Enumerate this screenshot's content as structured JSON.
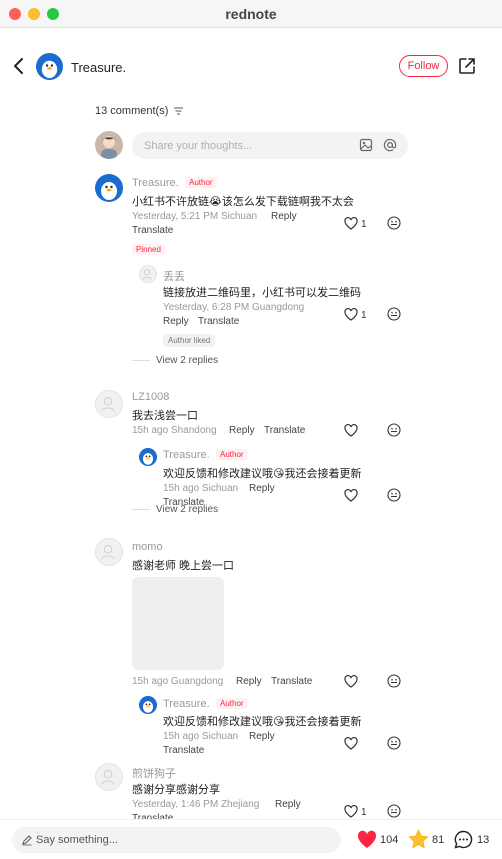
{
  "window": {
    "title": "rednote"
  },
  "header": {
    "author": "Treasure.",
    "follow_label": "Follow"
  },
  "comments_header": {
    "count_label": "13 comment(s)"
  },
  "composer": {
    "placeholder": "Share your thoughts..."
  },
  "comments": [
    {
      "user": "Treasure.",
      "badge": "Author",
      "text": "小红书不许放链😭该怎么发下载链啊我不太会",
      "meta": "Yesterday, 5:21 PM Sichuan",
      "reply": "Reply",
      "translate": "Translate",
      "pinned": "Pinned",
      "likes": "1",
      "replies": [
        {
          "user": "丢丢",
          "text": "链接放进二维码里，小红书可以发二维码",
          "meta": "Yesterday, 6:28 PM Guangdong",
          "reply": "Reply",
          "translate": "Translate",
          "author_liked": "Author liked",
          "likes": "1"
        }
      ],
      "view_replies": "View 2 replies"
    },
    {
      "user": "LZ1008",
      "text": "我去浅尝一口",
      "meta": "15h ago Shandong",
      "reply": "Reply",
      "translate": "Translate",
      "replies": [
        {
          "user": "Treasure.",
          "badge": "Author",
          "text": "欢迎反馈和修改建议哦😘我还会接着更新",
          "meta": "15h ago Sichuan",
          "reply": "Reply",
          "translate": "Translate"
        }
      ],
      "view_replies": "View 2 replies"
    },
    {
      "user": "momo",
      "text": "感谢老师 晚上尝一口",
      "meta": "15h ago Guangdong",
      "reply": "Reply",
      "translate": "Translate",
      "replies": [
        {
          "user": "Treasure.",
          "badge": "Author",
          "text": "欢迎反馈和修改建议哦😘我还会接着更新",
          "meta": "15h ago Sichuan",
          "reply": "Reply",
          "translate": "Translate"
        }
      ]
    },
    {
      "user": "煎饼狗子",
      "text": "感谢分享感谢分享",
      "meta": "Yesterday, 1:46 PM Zhejiang",
      "reply": "Reply",
      "translate": "Translate",
      "likes": "1"
    }
  ],
  "bottom_bar": {
    "placeholder": "Say something...",
    "likes": "104",
    "stars": "81",
    "comments": "13"
  },
  "colors": {
    "brand": "#ff2442",
    "author_avatar": "#1b6bd0"
  },
  "icons": [
    "back-arrow-icon",
    "share-icon",
    "sort-icon",
    "image-icon",
    "at-icon",
    "heart-icon",
    "smile-icon",
    "pen-icon",
    "star-icon",
    "chat-icon"
  ]
}
